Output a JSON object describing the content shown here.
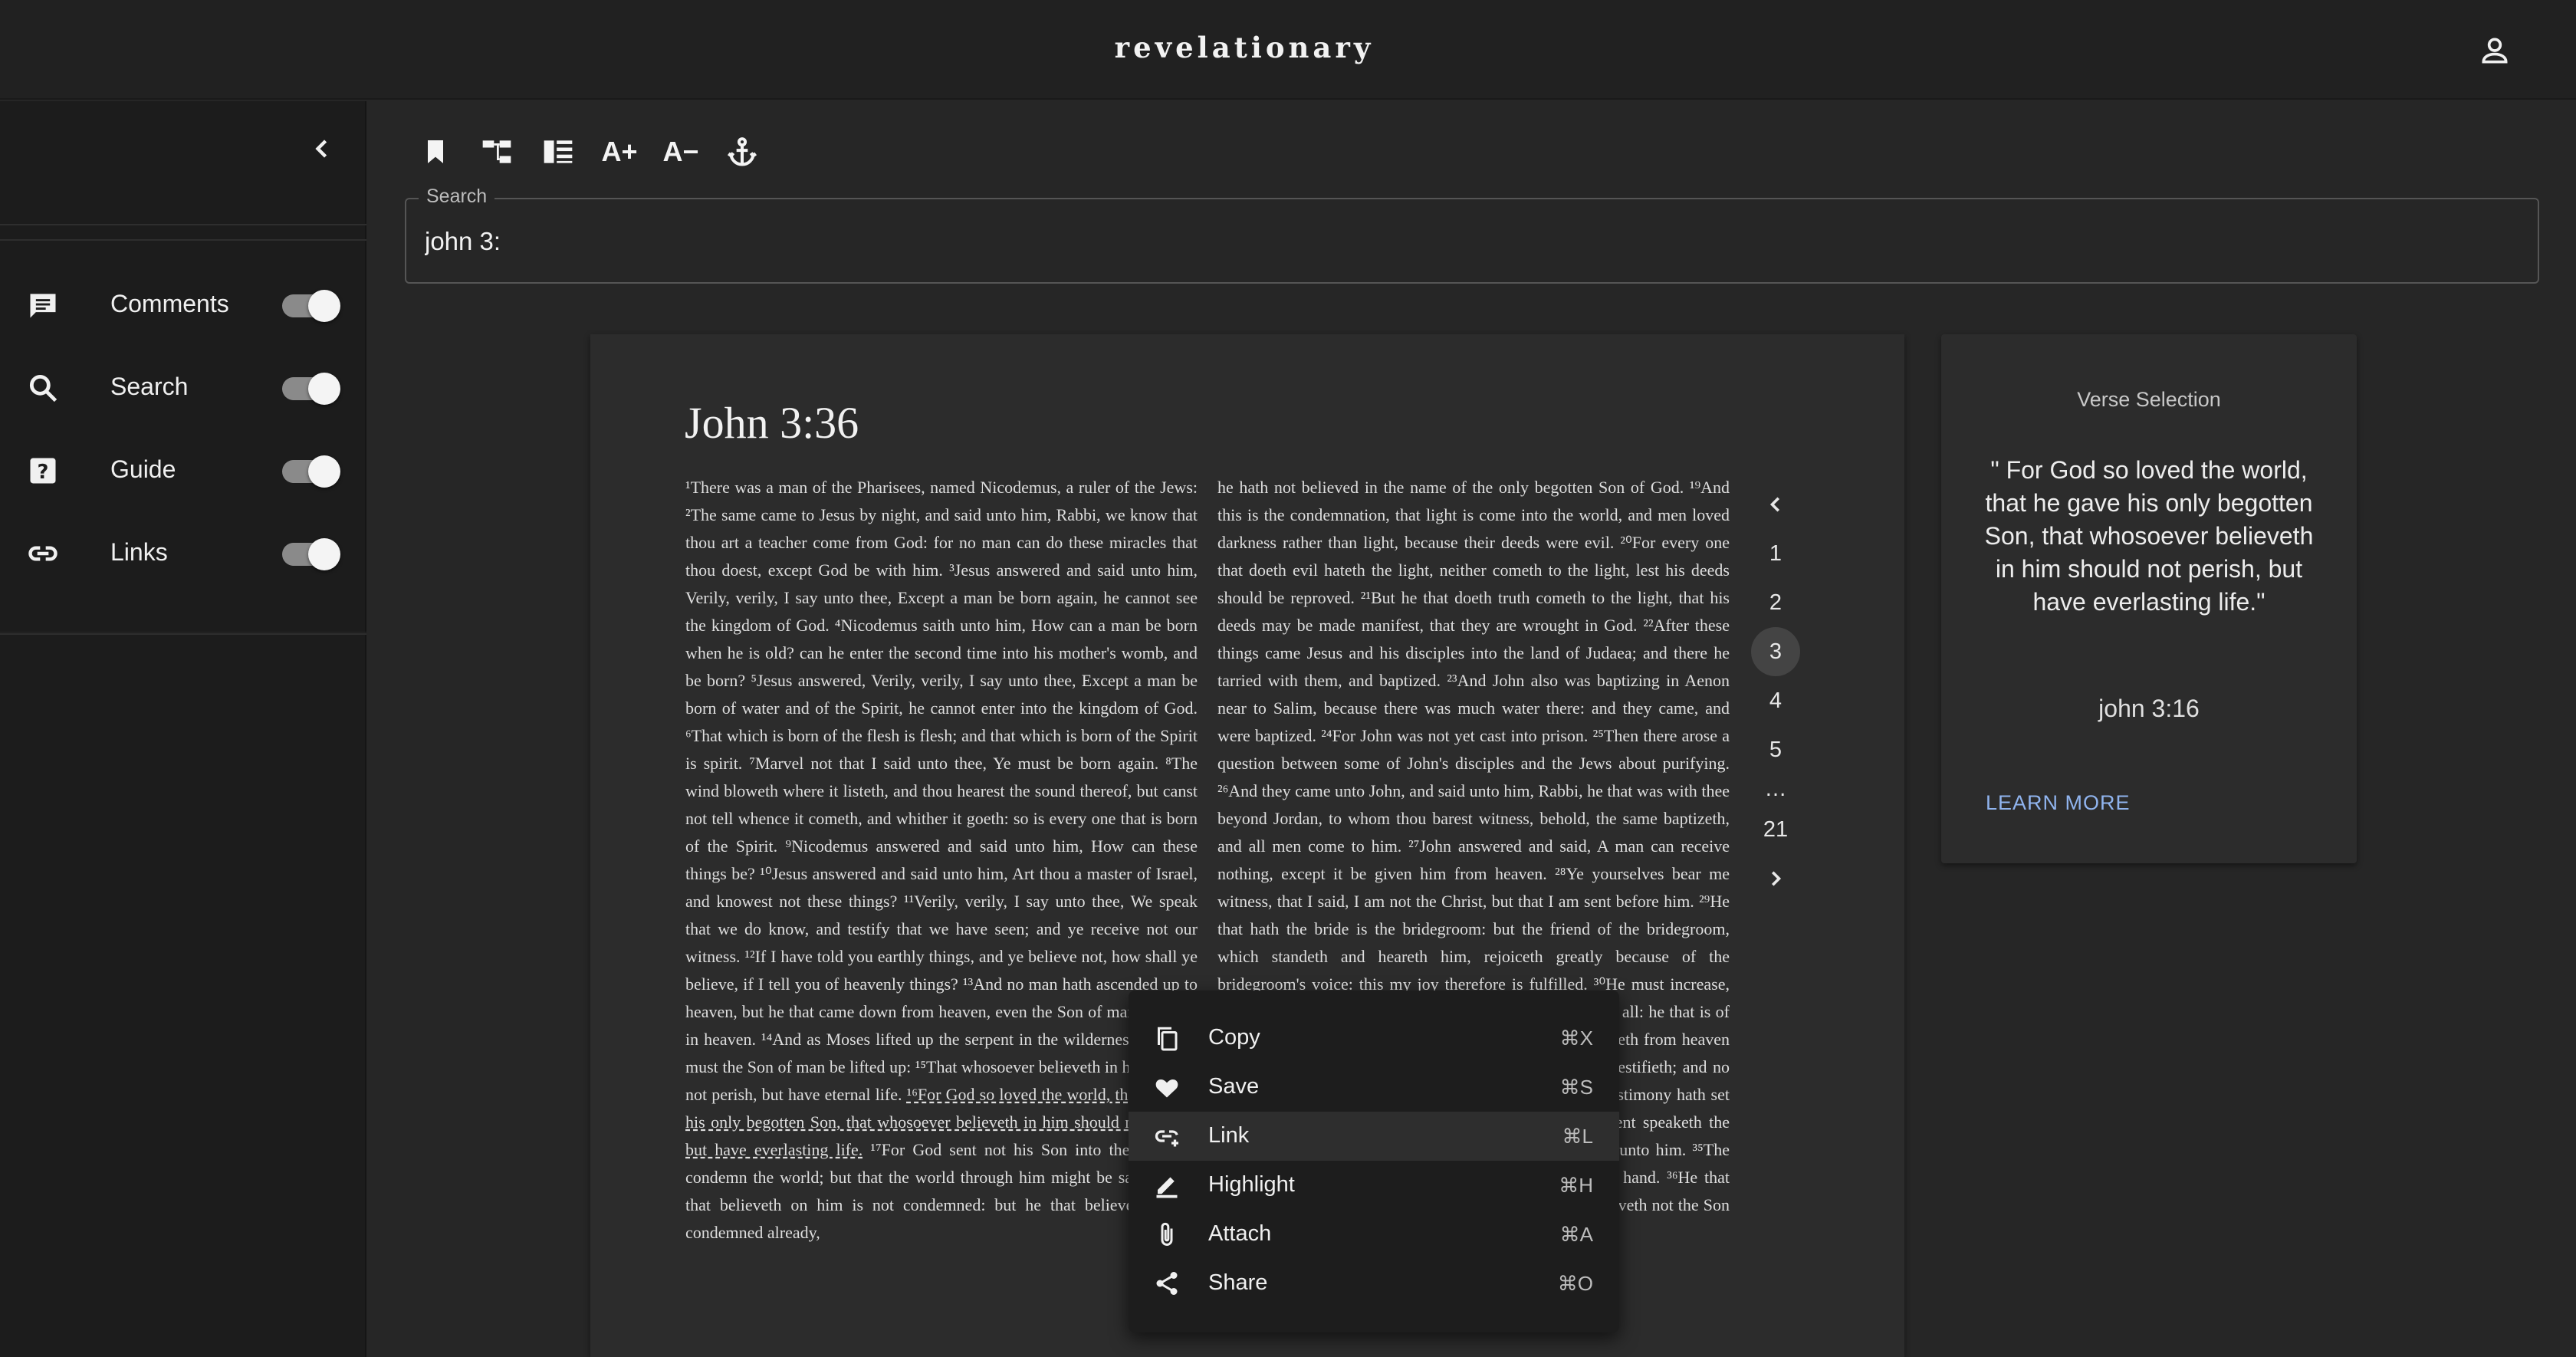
{
  "app": {
    "title": "revelationary"
  },
  "sidebar": {
    "items": [
      {
        "label": "Comments",
        "icon": "comment-icon",
        "enabled": true
      },
      {
        "label": "Search",
        "icon": "search-icon",
        "enabled": true
      },
      {
        "label": "Guide",
        "icon": "help-icon",
        "enabled": true
      },
      {
        "label": "Links",
        "icon": "link-icon",
        "enabled": true
      }
    ]
  },
  "toolbar": {
    "buttons": [
      "bookmark-icon",
      "tree-structure-icon",
      "columns-icon",
      "font-increase-icon",
      "font-decrease-icon",
      "anchor-icon"
    ],
    "font_increase_label": "A+",
    "font_decrease_label": "A−"
  },
  "search": {
    "label": "Search",
    "value": "john 3:"
  },
  "reader": {
    "title": "John 3:36",
    "left_text": "¹There was a man of the Pharisees, named Nicodemus, a ruler of the Jews: ²The same came to Jesus by night, and said unto him, Rabbi, we know that thou art a teacher come from God: for no man can do these miracles that thou doest, except God be with him. ³Jesus answered and said unto him, Verily, verily, I say unto thee, Except a man be born again, he cannot see the kingdom of God. ⁴Nicodemus saith unto him, How can a man be born when he is old? can he enter the second time into his mother's womb, and be born? ⁵Jesus answered, Verily, verily, I say unto thee, Except a man be born of water and of the Spirit, he cannot enter into the kingdom of God. ⁶That which is born of the flesh is flesh; and that which is born of the Spirit is spirit. ⁷Marvel not that I said unto thee, Ye must be born again. ⁸The wind bloweth where it listeth, and thou hearest the sound thereof, but canst not tell whence it cometh, and whither it goeth: so is every one that is born of the Spirit. ⁹Nicodemus answered and said unto him, How can these things be? ¹⁰Jesus answered and said unto him, Art thou a master of Israel, and knowest not these things? ¹¹Verily, verily, I say unto thee, We speak that we do know, and testify that we have seen; and ye receive not our witness. ¹²If I have told you earthly things, and ye believe not, how shall ye believe, if I tell you of heavenly things? ¹³And no man hath ascended up to heaven, but he that came down from heaven, even the Son of man which is in heaven. ¹⁴And as Moses lifted up the serpent in the wilderness, even so must the Son of man be lifted up: ¹⁵That whosoever believeth in him should not perish, but have eternal life.",
    "left_highlight": "¹⁶For God so loved the world, that he gave his only begotten Son, that whosoever believeth in him should not perish, but have everlasting life.",
    "left_tail": "¹⁷For God sent not his Son into the world to condemn the world; but that the world through him might be saved. ¹⁸He that believeth on him is not condemned: but he that believeth not is condemned already,",
    "right_text": "he hath not believed in the name of the only begotten Son of God. ¹⁹And this is the condemnation, that light is come into the world, and men loved darkness rather than light, because their deeds were evil. ²⁰For every one that doeth evil hateth the light, neither cometh to the light, lest his deeds should be reproved. ²¹But he that doeth truth cometh to the light, that his deeds may be made manifest, that they are wrought in God. ²²After these things came Jesus and his disciples into the land of Judaea; and there he tarried with them, and baptized. ²³And John also was baptizing in Aenon near to Salim, because there was much water there: and they came, and were baptized. ²⁴For John was not yet cast into prison. ²⁵Then there arose a question between some of John's disciples and the Jews about purifying. ²⁶And they came unto John, and said unto him, Rabbi, he that was with thee beyond Jordan, to whom thou barest witness, behold, the same baptizeth, and all men come to him. ²⁷John answered and said, A man can receive nothing, except it be given him from heaven. ²⁸Ye yourselves bear me witness, that I said, I am not the Christ, but that I am sent before him. ²⁹He that hath the bride is the bridegroom: but the friend of the bridegroom, which standeth and heareth him, rejoiceth greatly because of the bridegroom's voice: this my joy therefore is fulfilled. ³⁰He must increase, but I must decrease. ³¹He that cometh from above is above all: he that is of the earth is earthly, and speaketh of the earth: he that cometh from heaven is above all. ³²And what he hath seen and heard, that he testifieth; and no man receiveth his testimony. ³³He that hath received his testimony hath set to his seal that God is true. ³⁴For he whom God hath sent speaketh the words of God: for God giveth not the Spirit by measure unto him. ³⁵The Father loveth the Son, and hath given all things into his hand. ³⁶He that believeth on the Son hath everlasting life: and he that believeth not the Son shall not see life; but the wrath of God abideth on him."
  },
  "pagination": {
    "prev_icon": "chevron-left-icon",
    "next_icon": "chevron-right-icon",
    "pages": [
      "1",
      "2",
      "3",
      "4",
      "5",
      "…",
      "21"
    ],
    "current": "3"
  },
  "verse_card": {
    "title": "Verse Selection",
    "quote": "\" For God so loved the world, that he gave his only begotten Son, that whosoever believeth in him should not perish, but have everlasting life.\"",
    "reference": "john 3:16",
    "action": "LEARN MORE",
    "action_color": "#90b4ee"
  },
  "context_menu": {
    "items": [
      {
        "label": "Copy",
        "shortcut": "⌘X",
        "icon": "copy-icon"
      },
      {
        "label": "Save",
        "shortcut": "⌘S",
        "icon": "heart-icon"
      },
      {
        "label": "Link",
        "shortcut": "⌘L",
        "icon": "add-link-icon"
      },
      {
        "label": "Highlight",
        "shortcut": "⌘H",
        "icon": "pencil-icon"
      },
      {
        "label": "Attach",
        "shortcut": "⌘A",
        "icon": "paperclip-icon"
      },
      {
        "label": "Share",
        "shortcut": "⌘O",
        "icon": "share-icon"
      }
    ],
    "hovered": "Link"
  }
}
